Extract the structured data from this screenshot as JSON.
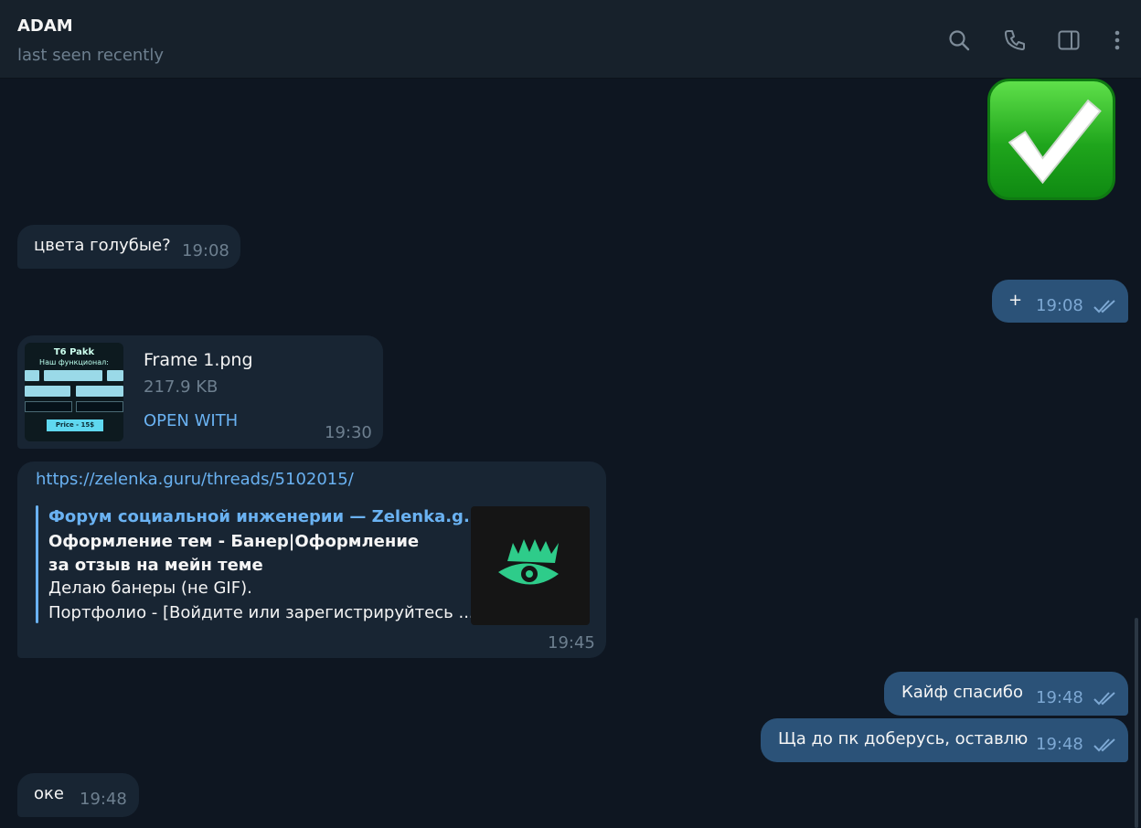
{
  "header": {
    "name": "ADAM",
    "status": "last seen recently",
    "icons": [
      "search-icon",
      "phone-icon",
      "sidebar-toggle-icon",
      "more-vertical-icon"
    ]
  },
  "messages": {
    "m1": {
      "text": "цвета голубые?",
      "time": "19:08"
    },
    "m2": {
      "text": "+",
      "time": "19:08",
      "read": true
    },
    "file": {
      "name": "Frame 1.png",
      "size": "217.9 KB",
      "action": "OPEN WITH",
      "time": "19:30",
      "thumb_title": "T6 Pakk",
      "thumb_subtitle": "Наш функционал:",
      "thumb_button": "Price - 15$"
    },
    "link": {
      "url": "https://zelenka.guru/threads/5102015/",
      "site": "Форум социальной инженерии —  Zelenka.g...",
      "title": "Оформление тем - Банер|Оформление за отзыв на мейн теме",
      "desc_line1": "Делаю банеры (не GIF).",
      "desc_line2": "Портфолио - [Войдите или зарегистрируйтесь ...",
      "time": "19:45"
    },
    "m5": {
      "text": "Кайф спасибо",
      "time": "19:48",
      "read": true
    },
    "m6": {
      "text": "Ща до пк доберусь, оставлю",
      "time": "19:48",
      "read": true
    },
    "m7": {
      "text": "оке",
      "time": "19:48"
    }
  },
  "colors": {
    "background": "#0e1621",
    "header": "#17212b",
    "incoming_bubble": "#182533",
    "outgoing_bubble": "#2b5278",
    "accent": "#6ab2f2",
    "sticker": "#1fa51c"
  }
}
